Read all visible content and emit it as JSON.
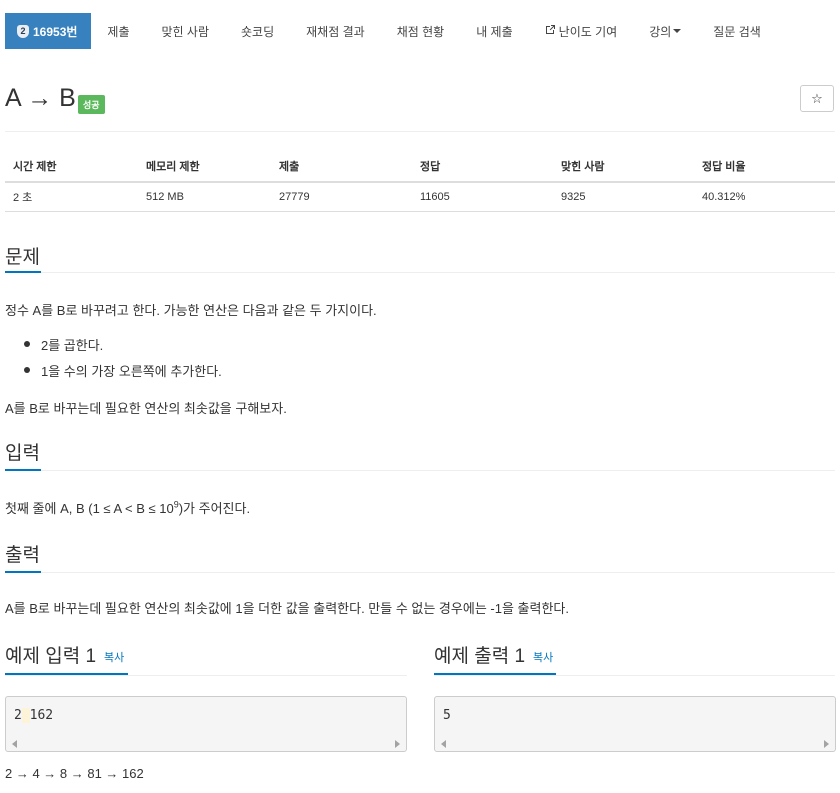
{
  "nav": {
    "problem_tier": "2",
    "problem_label": "16953번",
    "items": [
      "제출",
      "맞힌 사람",
      "숏코딩",
      "재채점 결과",
      "채점 현황",
      "내 제출",
      "난이도 기여",
      "강의",
      "질문 검색"
    ],
    "icons": {
      "contribute": "external-link-icon",
      "lecture": "caret-down-icon"
    }
  },
  "problem": {
    "title": "A → B",
    "status_badge": "성공",
    "star_icon": "star-icon",
    "colors": {
      "accent": "#0076c0",
      "nav_active": "#3681be",
      "success": "#5cb85c"
    }
  },
  "info": {
    "headers": [
      "시간 제한",
      "메모리 제한",
      "제출",
      "정답",
      "맞힌 사람",
      "정답 비율"
    ],
    "values": [
      "2 초",
      "512 MB",
      "27779",
      "11605",
      "9325",
      "40.312%"
    ]
  },
  "statement": {
    "heading": "문제",
    "intro": "정수 A를 B로 바꾸려고 한다. 가능한 연산은 다음과 같은 두 가지이다.",
    "ops": [
      "2를 곱한다.",
      "1을 수의 가장 오른쪽에 추가한다."
    ],
    "goal": "A를 B로 바꾸는데 필요한 연산의 최솟값을 구해보자."
  },
  "input": {
    "heading": "입력",
    "text_before": "첫째 줄에 A, B (1 ≤ A < B ≤ 10",
    "exponent": "9",
    "text_after": ")가 주어진다."
  },
  "output": {
    "heading": "출력",
    "text": "A를 B로 바꾸는데 필요한 연산의 최솟값에 1을 더한 값을 출력한다. 만들 수 없는 경우에는 -1을 출력한다."
  },
  "examples": {
    "input_title": "예제 입력 1",
    "output_title": "예제 출력 1",
    "copy_label": "복사",
    "input_first": "2",
    "input_space": " ",
    "input_rest": "162",
    "output_value": "5",
    "explanation": "2 → 4 → 8 → 81 → 162"
  }
}
